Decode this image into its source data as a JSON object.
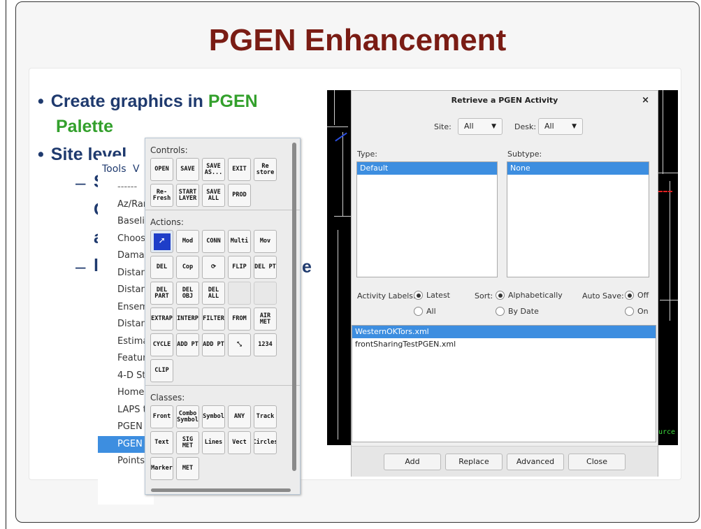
{
  "slide": {
    "title": "PGEN Enhancement",
    "bullet1_part1": "Create graphics in ",
    "bullet1_green": "PGEN",
    "bullet1_line2": "Palette",
    "bullet2": "Site level",
    "frag_s": "S",
    "frag_c": "C",
    "frag_a": "a",
    "frag_l": "l",
    "frag_e": "e",
    "bullet_glyph": "•",
    "dash_glyph": "–",
    "colors": {
      "title": "#7a1c14",
      "bullet": "#1f3a6e",
      "green": "#33a02c",
      "selection": "#3d8ee0"
    }
  },
  "tools_menu": {
    "header": "Tools",
    "header_next": "V",
    "items": [
      {
        "label": "------",
        "separator": true
      },
      {
        "label": "Az/Ran"
      },
      {
        "label": "Baselin"
      },
      {
        "label": "Choose"
      },
      {
        "label": "Damag"
      },
      {
        "label": "Distanc"
      },
      {
        "label": "Distanc"
      },
      {
        "label": "Ensem"
      },
      {
        "label": "Distanc"
      },
      {
        "label": "Estima"
      },
      {
        "label": "Featur"
      },
      {
        "label": "4-D St"
      },
      {
        "label": "Home"
      },
      {
        "label": "LAPS t"
      },
      {
        "label": "PGEN"
      },
      {
        "label": "PGEN",
        "selected": true
      },
      {
        "label": "Points"
      }
    ]
  },
  "palette": {
    "controls_label": "Controls:",
    "controls": [
      [
        "OPEN",
        "SAVE",
        "SAVE AS...",
        "EXIT",
        "Re store"
      ],
      [
        "Re- Fresh",
        "START LAYER",
        "SAVE ALL",
        "PROD"
      ]
    ],
    "actions_label": "Actions:",
    "actions": [
      [
        "➚",
        "Mod",
        "CONN",
        "Multi",
        "Mov"
      ],
      [
        "DEL",
        "Cop",
        "⟳",
        "FLIP",
        "DEL PT"
      ],
      [
        "DEL PART",
        "DEL OBJ",
        "DEL ALL",
        "",
        ""
      ],
      [
        "EXTRAP",
        "INTERP",
        "FILTER",
        "FROM",
        "AIR MET"
      ],
      [
        "CYCLE",
        "ADD PT",
        "ADD PT",
        "⤡",
        "1234"
      ],
      [
        "CLIP"
      ]
    ],
    "classes_label": "Classes:",
    "classes": [
      [
        "Front",
        "Combo Symbol",
        "Symbol",
        "ANY",
        "Track"
      ],
      [
        "Text",
        "SIG MET",
        "Lines",
        "Vect",
        "Circles"
      ],
      [
        "Marker",
        "MET"
      ]
    ]
  },
  "dialog": {
    "title": "Retrieve a PGEN Activity",
    "close": "×",
    "site_label": "Site:",
    "site_value": "All",
    "desk_label": "Desk:",
    "desk_value": "All",
    "dropdown_arrow": "▼",
    "type_label": "Type:",
    "type_items": [
      "Default"
    ],
    "subtype_label": "Subtype:",
    "subtype_items": [
      "None"
    ],
    "activity_labels_label": "Activity Labels:",
    "activity_latest": "Latest",
    "activity_all": "All",
    "sort_label": "Sort:",
    "sort_alpha": "Alphabetically",
    "sort_date": "By Date",
    "autosave_label": "Auto Save:",
    "autosave_off": "Off",
    "autosave_on": "On",
    "files": [
      "WesternOKTors.xml",
      "frontSharingTestPGEN.xml"
    ],
    "buttons": {
      "add": "Add",
      "replace": "Replace",
      "advanced": "Advanced",
      "close": "Close"
    }
  },
  "map": {
    "corner_text": "urce"
  }
}
